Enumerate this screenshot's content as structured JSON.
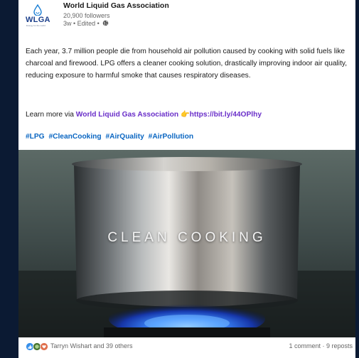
{
  "post": {
    "org_name": "World Liquid Gas Association",
    "logo_text": "WLGA",
    "logo_tagline": "Energy for the world",
    "followers": "20,900 followers",
    "meta": "3w • Edited •",
    "body": "Each year, 3.7 million people die from household air pollution caused by cooking with solid fuels like charcoal and firewood. LPG offers a cleaner cooking solution, drastically improving indoor air quality, reducing exposure to harmful smoke that causes respiratory diseases.",
    "learn_prefix": "Learn more via",
    "learn_link": "World Liquid Gas Association",
    "learn_emoji": "👉",
    "learn_url": "https://bit.ly/44OPlhy",
    "hashtags": [
      "#LPG",
      "#CleanCooking",
      "#AirQuality",
      "#AirPollution"
    ],
    "image_overlay": "CLEAN COOKING",
    "reactions_text": "Tarryn Wishart and 39 others",
    "stats_text": "1 comment · 9 reposts"
  },
  "colors": {
    "page_bg": "#0b1a33",
    "link_purple": "#6a2fc9",
    "hashtag_blue": "#0a66c2",
    "logo_blue": "#1b3f8b"
  },
  "icons": [
    "wlga-drop-icon",
    "globe-icon",
    "like-reaction-icon",
    "celebrate-reaction-icon",
    "love-reaction-icon"
  ]
}
